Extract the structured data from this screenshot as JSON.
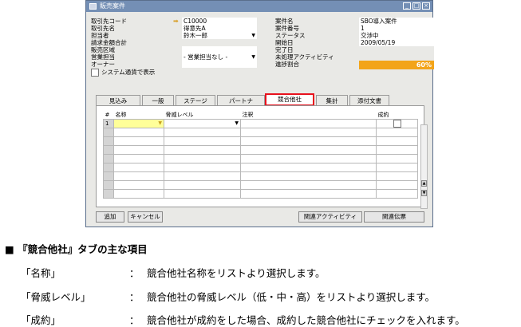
{
  "window": {
    "title": "販売案件"
  },
  "fields_left": [
    {
      "label": "取引先コード",
      "value": "C10000",
      "arrow": true
    },
    {
      "label": "取引先名",
      "value": "得意先A"
    },
    {
      "label": "担当者",
      "value": "鈴木一郎",
      "dropdown": true
    },
    {
      "label": "請求金額合計",
      "value": ""
    },
    {
      "label": "販売区域",
      "value": ""
    },
    {
      "label": "営業担当",
      "value": "- 営業担当なし -",
      "dropdown": true
    },
    {
      "label": "オーナー",
      "value": ""
    }
  ],
  "fields_right": [
    {
      "label": "案件名",
      "value": "SBO導入案件"
    },
    {
      "label": "案件番号",
      "value": "1"
    },
    {
      "label": "ステータス",
      "value": "交渉中"
    },
    {
      "label": "開始日",
      "value": "2009/05/19"
    },
    {
      "label": "完了日",
      "value": ""
    },
    {
      "label": "未処理アクティビティ",
      "value": ""
    },
    {
      "label": "進捗割合",
      "value": "60%"
    }
  ],
  "progress_fraction": 0.6,
  "system_checkbox_label": "システム通貨で表示",
  "tabs": [
    "見込み",
    "一般",
    "ステージ",
    "パートナ",
    "競合他社",
    "集計",
    "添付文書"
  ],
  "active_tab": "競合他社",
  "grid": {
    "headers": [
      "#",
      "名称",
      "脅威レベル",
      "注釈",
      "成約"
    ],
    "first_row_number": "1"
  },
  "buttons": {
    "add": "追加",
    "cancel": "キャンセル",
    "related_activity": "関連アクティビティ",
    "related_docs": "関連伝票"
  },
  "description": {
    "heading": "■ 『競合他社』タブの主な項目",
    "items": [
      {
        "term": "「名称」",
        "colon": "：",
        "text": "競合他社名称をリストより選択します。"
      },
      {
        "term": "「脅威レベル」",
        "colon": "：",
        "text": "競合他社の脅威レベル（低・中・高）をリストより選択します。"
      },
      {
        "term": "「成約」",
        "colon": "：",
        "text": "競合他社が成約をした場合、成約した競合他社にチェックを入れます。"
      }
    ]
  }
}
